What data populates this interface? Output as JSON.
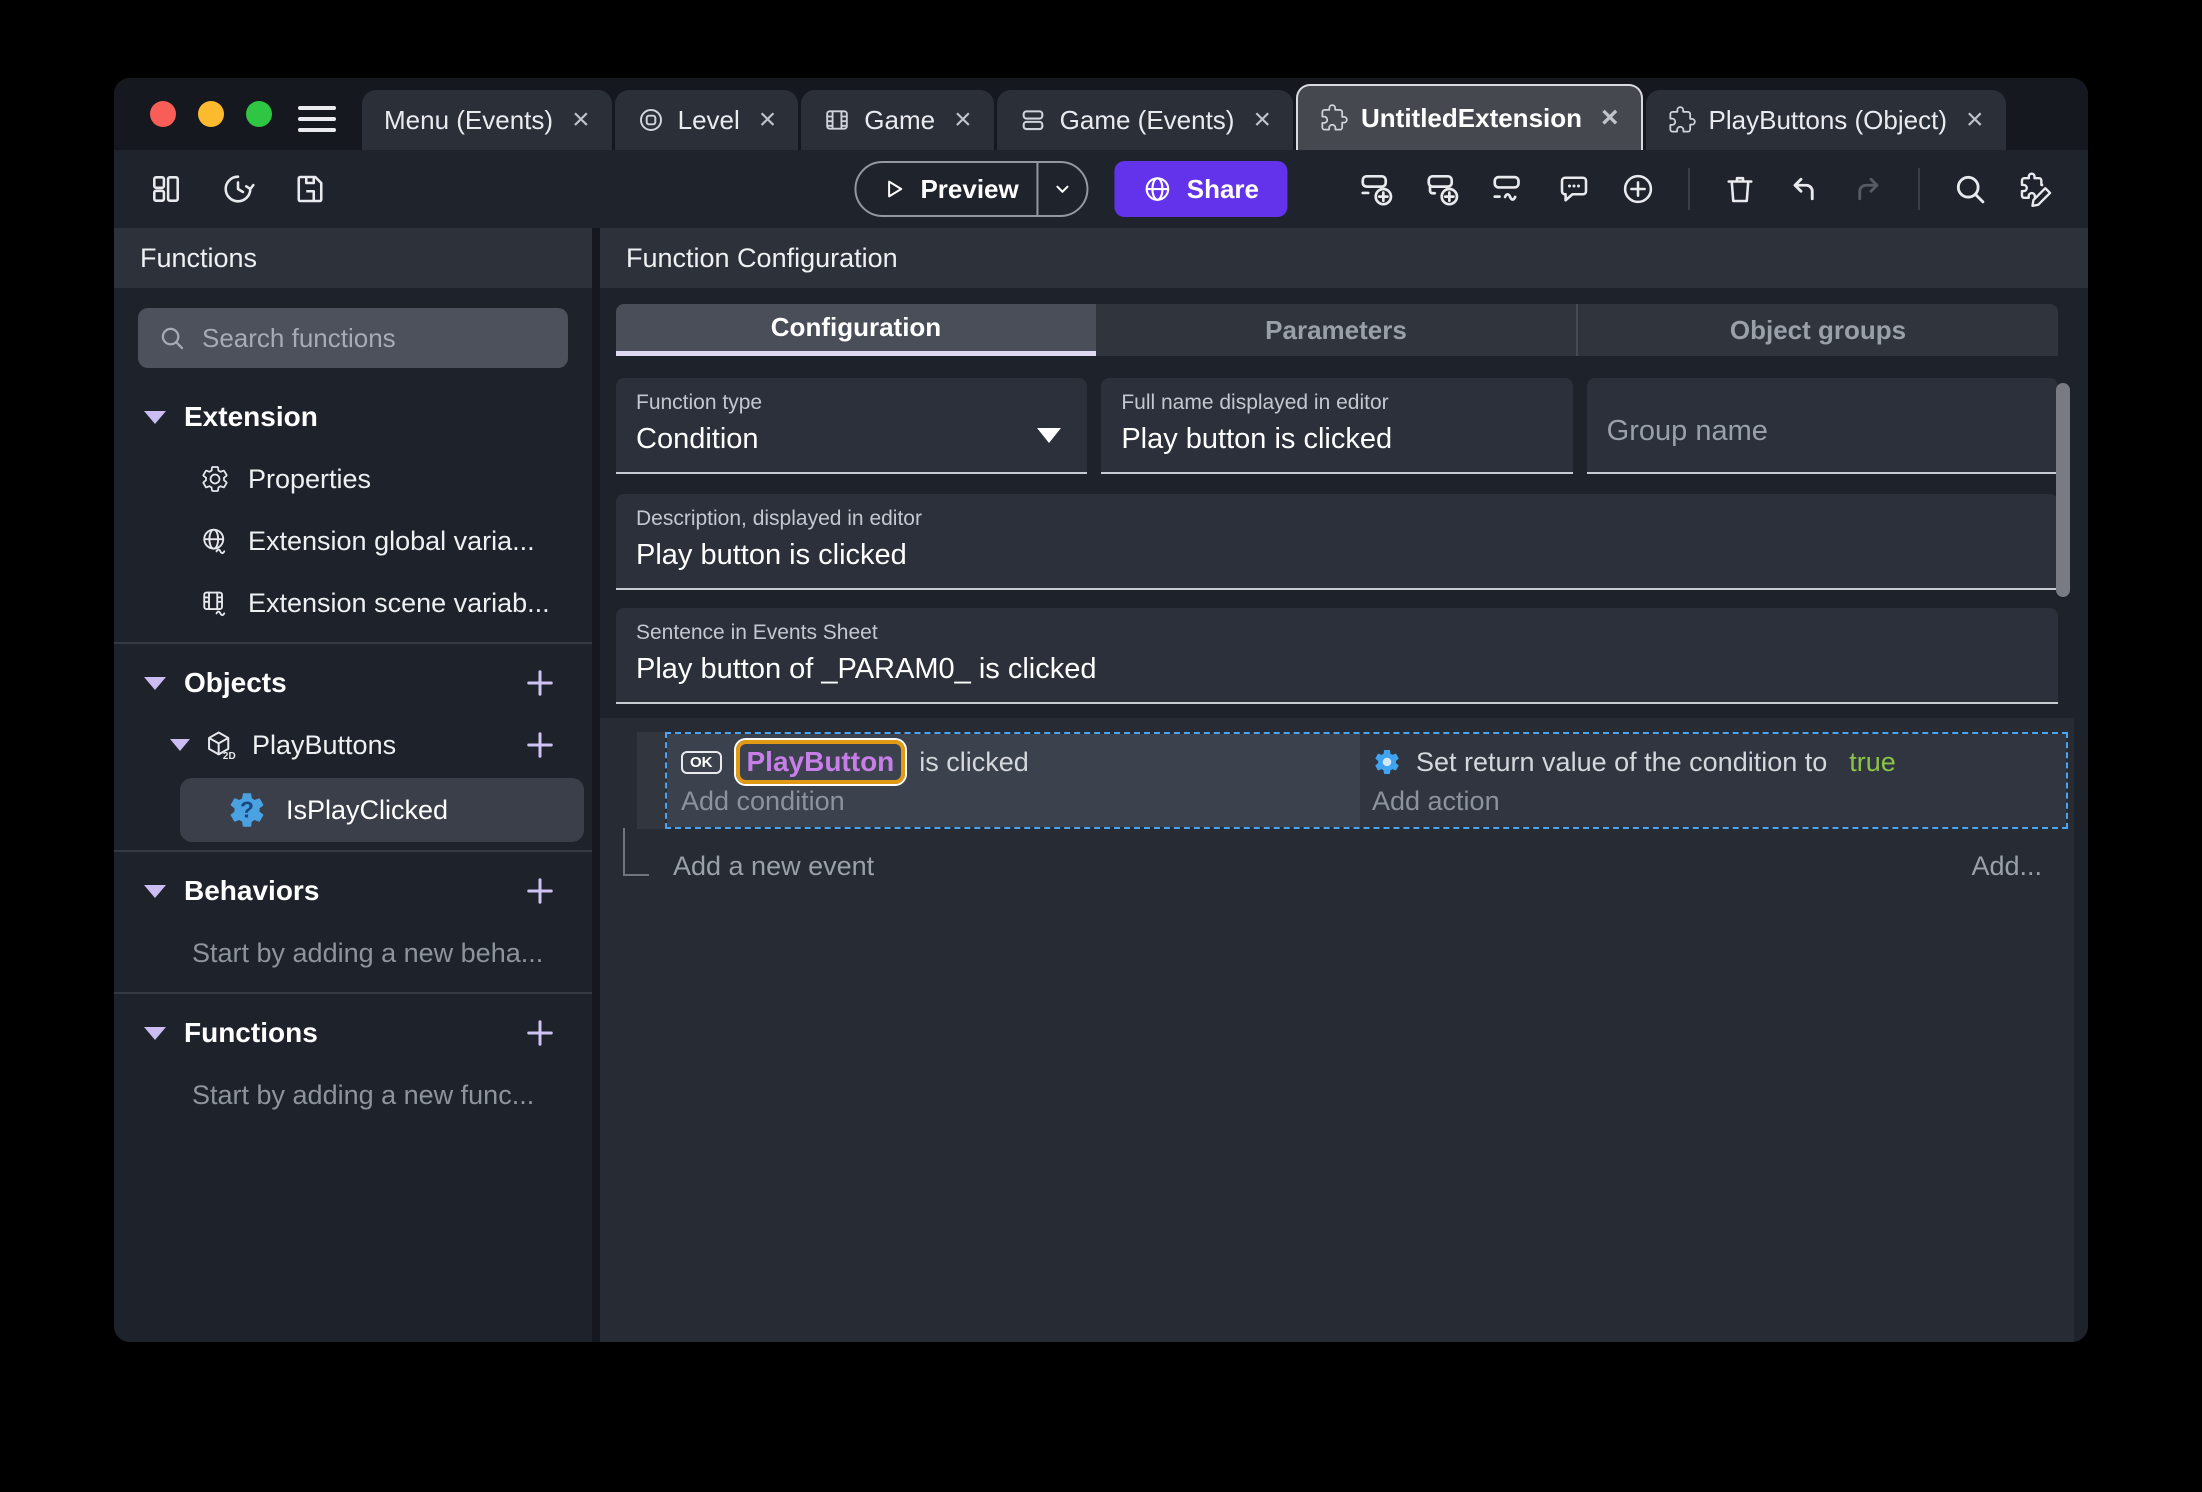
{
  "titlebar": {
    "close_glyph": "×",
    "tabs": [
      {
        "label": "Menu (Events)"
      },
      {
        "label": "Level"
      },
      {
        "label": "Game"
      },
      {
        "label": "Game (Events)"
      },
      {
        "label": "UntitledExtension"
      },
      {
        "label": "PlayButtons (Object)"
      }
    ]
  },
  "toolbar": {
    "preview_label": "Preview",
    "share_label": "Share"
  },
  "sidebar": {
    "title": "Functions",
    "search_placeholder": "Search functions",
    "extension_section": {
      "label": "Extension"
    },
    "extension_items": [
      {
        "label": "Properties"
      },
      {
        "label": "Extension global varia..."
      },
      {
        "label": "Extension scene variab..."
      }
    ],
    "objects_section": {
      "label": "Objects"
    },
    "object_group": {
      "label": "PlayButtons"
    },
    "object_function": {
      "label": "IsPlayClicked"
    },
    "behaviors_section": {
      "label": "Behaviors",
      "hint": "Start by adding a new beha..."
    },
    "functions_section": {
      "label": "Functions",
      "hint": "Start by adding a new func..."
    }
  },
  "main": {
    "title": "Function Configuration",
    "tabs": [
      {
        "label": "Configuration"
      },
      {
        "label": "Parameters"
      },
      {
        "label": "Object groups"
      }
    ],
    "fields": {
      "function_type": {
        "label": "Function type",
        "value": "Condition"
      },
      "full_name": {
        "label": "Full name displayed in editor",
        "value": "Play button is clicked"
      },
      "group_name": {
        "placeholder": "Group name"
      },
      "description": {
        "label": "Description, displayed in editor",
        "value": "Play button is clicked"
      },
      "sentence": {
        "label": "Sentence in Events Sheet",
        "value": "Play button of _PARAM0_ is clicked"
      }
    },
    "events": {
      "condition": {
        "ok_badge": "OK",
        "object_name": "PlayButton",
        "suffix": "is clicked",
        "add_label": "Add condition"
      },
      "action": {
        "prefix": "Set return value of the condition to",
        "value": "true",
        "add_label": "Add action"
      },
      "add_new_event_label": "Add a new event",
      "add_more_label": "Add..."
    }
  },
  "colors": {
    "accent_purple": "#6233ea",
    "object_chip_text": "#c77ee8",
    "object_chip_border": "#e09a14",
    "boolean_true_green": "#8bc34a",
    "selection_dashed_blue": "#4aa4f1",
    "selected_row_bg": "#3a3f4a"
  }
}
